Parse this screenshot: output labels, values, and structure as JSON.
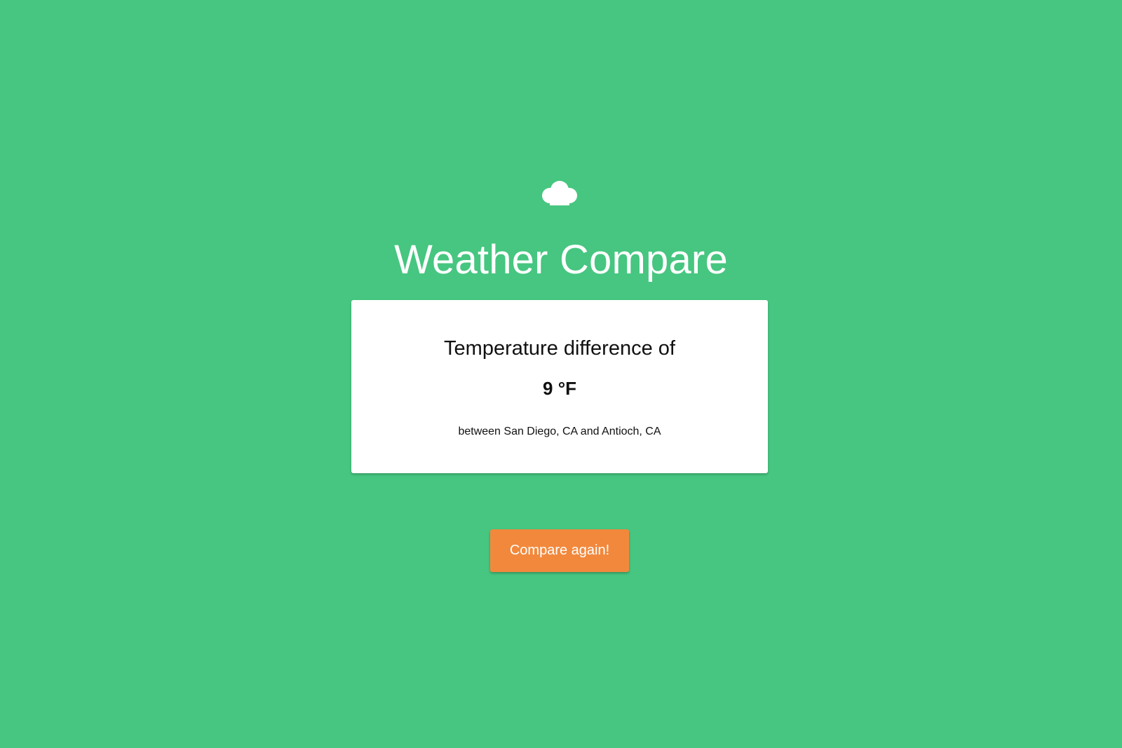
{
  "app": {
    "title": "Weather Compare",
    "icon": "cloud-icon"
  },
  "result_card": {
    "heading": "Temperature difference of",
    "value": "9 °F",
    "detail": "between San Diego, CA and Antioch, CA"
  },
  "actions": {
    "compare_again_label": "Compare again!"
  },
  "colors": {
    "background": "#46c680",
    "card": "#ffffff",
    "button": "#f2883c",
    "title_text": "#ffffff",
    "card_text": "#111111"
  }
}
